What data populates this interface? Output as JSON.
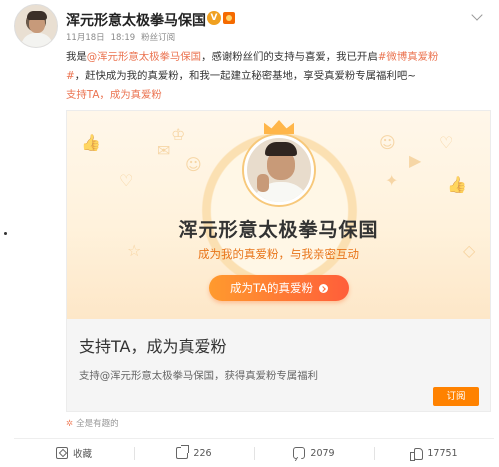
{
  "post": {
    "author": "浑元形意太极拳马保国",
    "badge_v": "V",
    "meta": {
      "date": "11月18日",
      "time": "18:19",
      "source": "粉丝订阅"
    },
    "body": {
      "line1_prefix": "我是",
      "line1_mention": "@浑元形意太极拳马保国",
      "line1_mid": "，感谢粉丝们的支持与喜爱，我已开启",
      "line1_tag": "#微博真爱粉",
      "line2_tag_end": "#",
      "line2_text": "，赶快成为我的真爱粉，和我一起建立秘密基地，享受真爱粉专属福利吧~",
      "link_text": "支持TA，成为真爱粉"
    }
  },
  "card": {
    "title": "浑元形意太极拳马保国",
    "subtitle": "成为我的真爱粉，与我亲密互动",
    "cta_label": "成为TA的真爱粉",
    "bottom_title": "支持TA，成为真爱粉",
    "bottom_desc": "支持@浑元形意太极拳马保国，获得真爱粉专属福利",
    "subscribe_label": "订阅"
  },
  "source_line": "全是有趣的",
  "actions": {
    "favorite_label": "收藏",
    "share_count": "226",
    "comment_count": "2079",
    "like_count": "17751"
  },
  "colors": {
    "link": "#eb7350",
    "accent_orange": "#ff8200",
    "cta_start": "#ff9a2e",
    "cta_end": "#ff5e3a",
    "card_bg": "#fff2dc"
  }
}
